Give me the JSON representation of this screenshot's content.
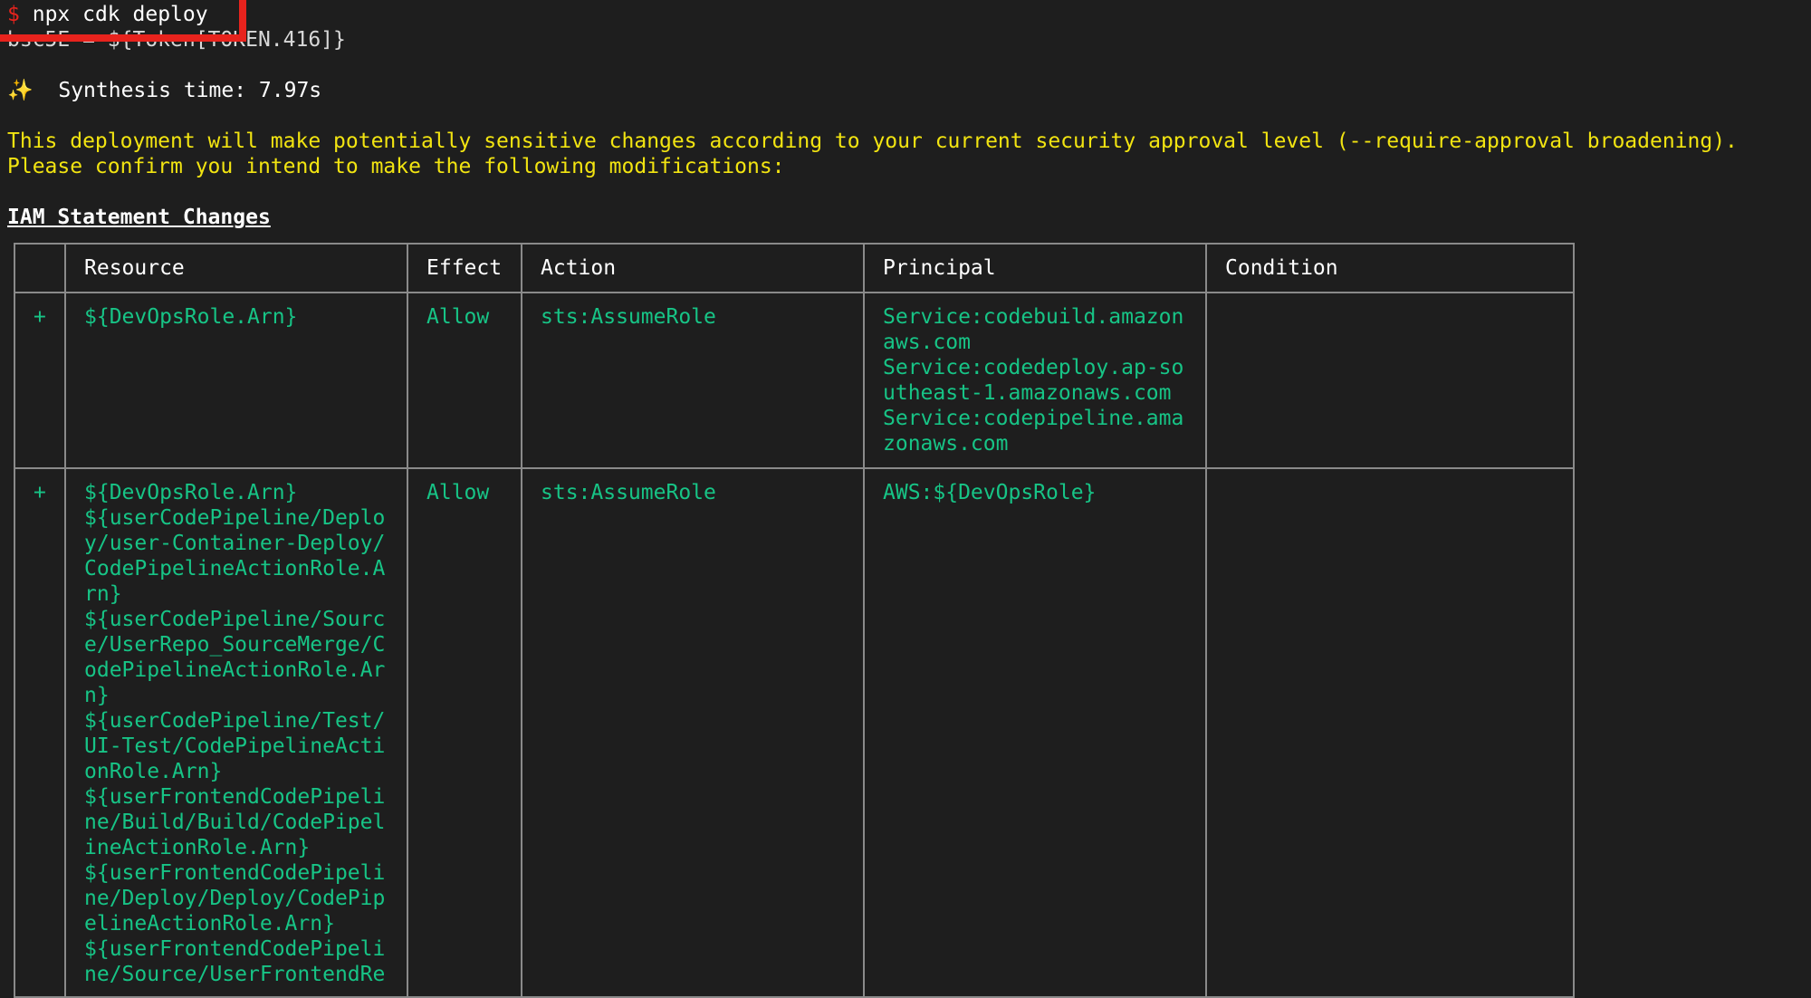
{
  "terminal": {
    "prompt_symbol": "$",
    "command": "npx cdk deploy",
    "overlapped_line": "bsc5E = ${Token[TOKEN.416]}",
    "sparkle": "✨",
    "synthesis_line": "Synthesis time: 7.97s",
    "warning_line1": "This deployment will make potentially sensitive changes according to your current security approval level (--require-approval broadening).",
    "warning_line2": "Please confirm you intend to make the following modifications:",
    "section_title": "IAM Statement Changes"
  },
  "table": {
    "headers": [
      "",
      "Resource",
      "Effect",
      "Action",
      "Principal",
      "Condition"
    ],
    "rows": [
      {
        "marker": "+",
        "resource_lines": [
          "${DevOpsRole.Arn}"
        ],
        "effect": "Allow",
        "action": "sts:AssumeRole",
        "principal_lines": [
          "Service:codebuild.amazon",
          "aws.com",
          "Service:codedeploy.ap-so",
          "utheast-1.amazonaws.com",
          "Service:codepipeline.ama",
          "zonaws.com"
        ],
        "condition": ""
      },
      {
        "marker": "+",
        "resource_lines": [
          "${DevOpsRole.Arn}",
          "${userCodePipeline/Deplo",
          "y/user-Container-Deploy/",
          "CodePipelineActionRole.A",
          "rn}",
          "${userCodePipeline/Sourc",
          "e/UserRepo_SourceMerge/C",
          "odePipelineActionRole.Ar",
          "n}",
          "${userCodePipeline/Test/",
          "UI-Test/CodePipelineActi",
          "onRole.Arn}",
          "${userFrontendCodePipeli",
          "ne/Build/Build/CodePipel",
          "ineActionRole.Arn}",
          "${userFrontendCodePipeli",
          "ne/Deploy/Deploy/CodePip",
          "elineActionRole.Arn}",
          "${userFrontendCodePipeli",
          "ne/Source/UserFrontendRe"
        ],
        "effect": "Allow",
        "action": "sts:AssumeRole",
        "principal_lines": [
          "AWS:${DevOpsRole}"
        ],
        "condition": ""
      }
    ]
  }
}
